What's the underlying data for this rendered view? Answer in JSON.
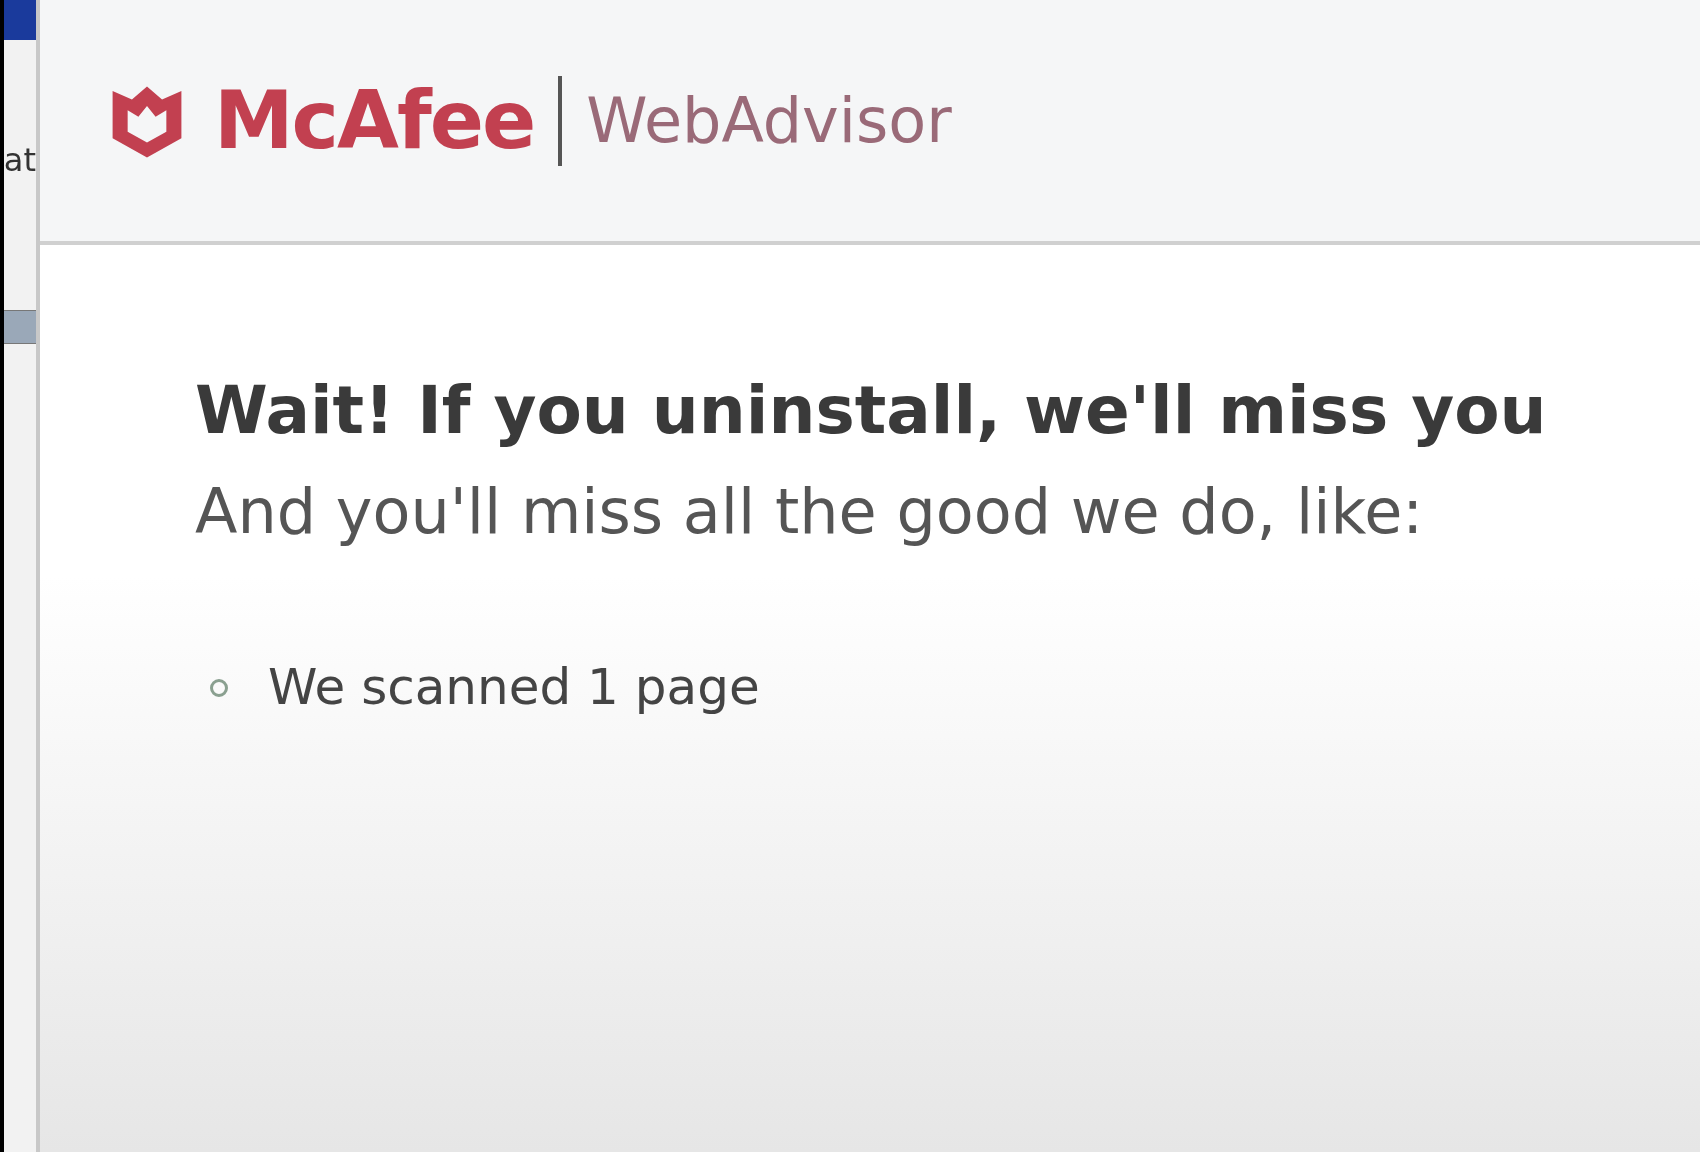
{
  "side_strip": {
    "text": "at"
  },
  "header": {
    "brand": "McAfee",
    "product": "WebAdvisor"
  },
  "heading": "Wait! If you uninstall, we'll miss you",
  "subheading": "And you'll miss all the good we do, like:",
  "benefits": [
    "We scanned 1 page"
  ]
}
